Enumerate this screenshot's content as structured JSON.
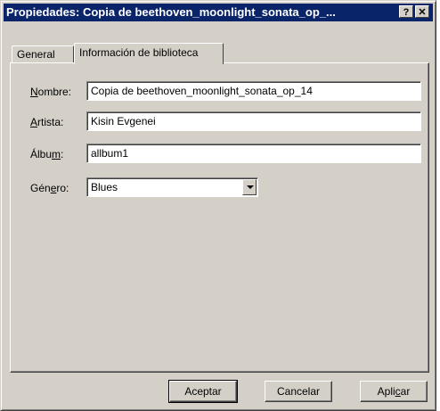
{
  "window": {
    "title": "Propiedades: Copia de beethoven_moonlight_sonata_op_...",
    "help_label": "?",
    "close_label": "✕"
  },
  "tabs": [
    {
      "label": "General"
    },
    {
      "label": "Información de biblioteca"
    }
  ],
  "form": {
    "name_label_pre": "",
    "name_label_u": "N",
    "name_label_post": "ombre:",
    "name_value": "Copia de beethoven_moonlight_sonata_op_14",
    "artist_label_pre": "",
    "artist_label_u": "A",
    "artist_label_post": "rtista:",
    "artist_value": "Kisin Evgenei",
    "album_label_pre": "Álbu",
    "album_label_u": "m",
    "album_label_post": ":",
    "album_value": "allbum1",
    "genre_label_pre": "Gén",
    "genre_label_u": "e",
    "genre_label_post": "ro:",
    "genre_value": "Blues"
  },
  "buttons": {
    "ok_label": "Aceptar",
    "cancel_label": "Cancelar",
    "apply_pre": "Apli",
    "apply_u": "c",
    "apply_post": "ar"
  }
}
